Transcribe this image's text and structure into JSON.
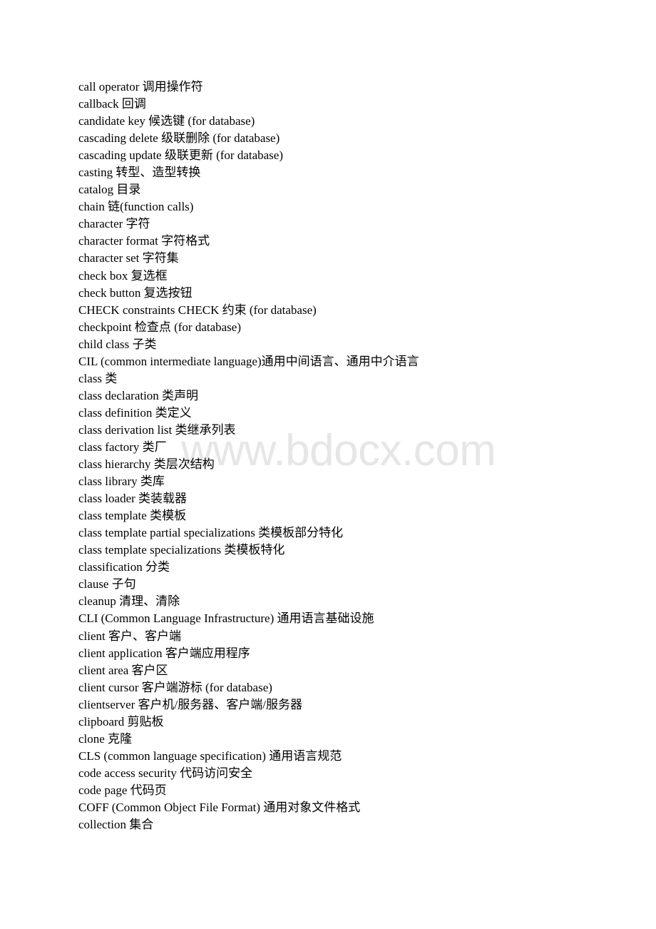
{
  "document": {
    "watermark": "www.bdocx.com",
    "entries": [
      "call operator 调用操作符",
      "callback 回调",
      "candidate key 候选键 (for database)",
      "cascading delete 级联删除 (for database)",
      "cascading update 级联更新 (for database)",
      "casting 转型、造型转换",
      "catalog 目录",
      "chain 链(function calls)",
      "character 字符",
      "character format 字符格式",
      "character set 字符集",
      "check box 复选框",
      "check button 复选按钮",
      "CHECK constraints CHECK 约束 (for database)",
      "checkpoint 检查点 (for database)",
      "child class 子类",
      "CIL (common intermediate language)通用中间语言、通用中介语言",
      "class 类",
      "class declaration 类声明",
      "class definition 类定义",
      "class derivation list 类继承列表",
      "class factory 类厂",
      "class hierarchy 类层次结构",
      "class library 类库",
      "class loader 类装载器",
      "class template 类模板",
      "class template partial specializations 类模板部分特化",
      "class template specializations 类模板特化",
      "classification 分类",
      "clause 子句",
      "cleanup 清理、清除",
      "CLI (Common Language Infrastructure) 通用语言基础设施",
      "client 客户、客户端",
      "client application 客户端应用程序",
      "client area 客户区",
      "client cursor 客户端游标 (for database)",
      "clientserver 客户机/服务器、客户端/服务器",
      "clipboard 剪贴板",
      "clone 克隆",
      "CLS (common language specification) 通用语言规范",
      "code access security 代码访问安全",
      "code page 代码页",
      "COFF (Common Object File Format) 通用对象文件格式",
      "collection 集合"
    ]
  }
}
